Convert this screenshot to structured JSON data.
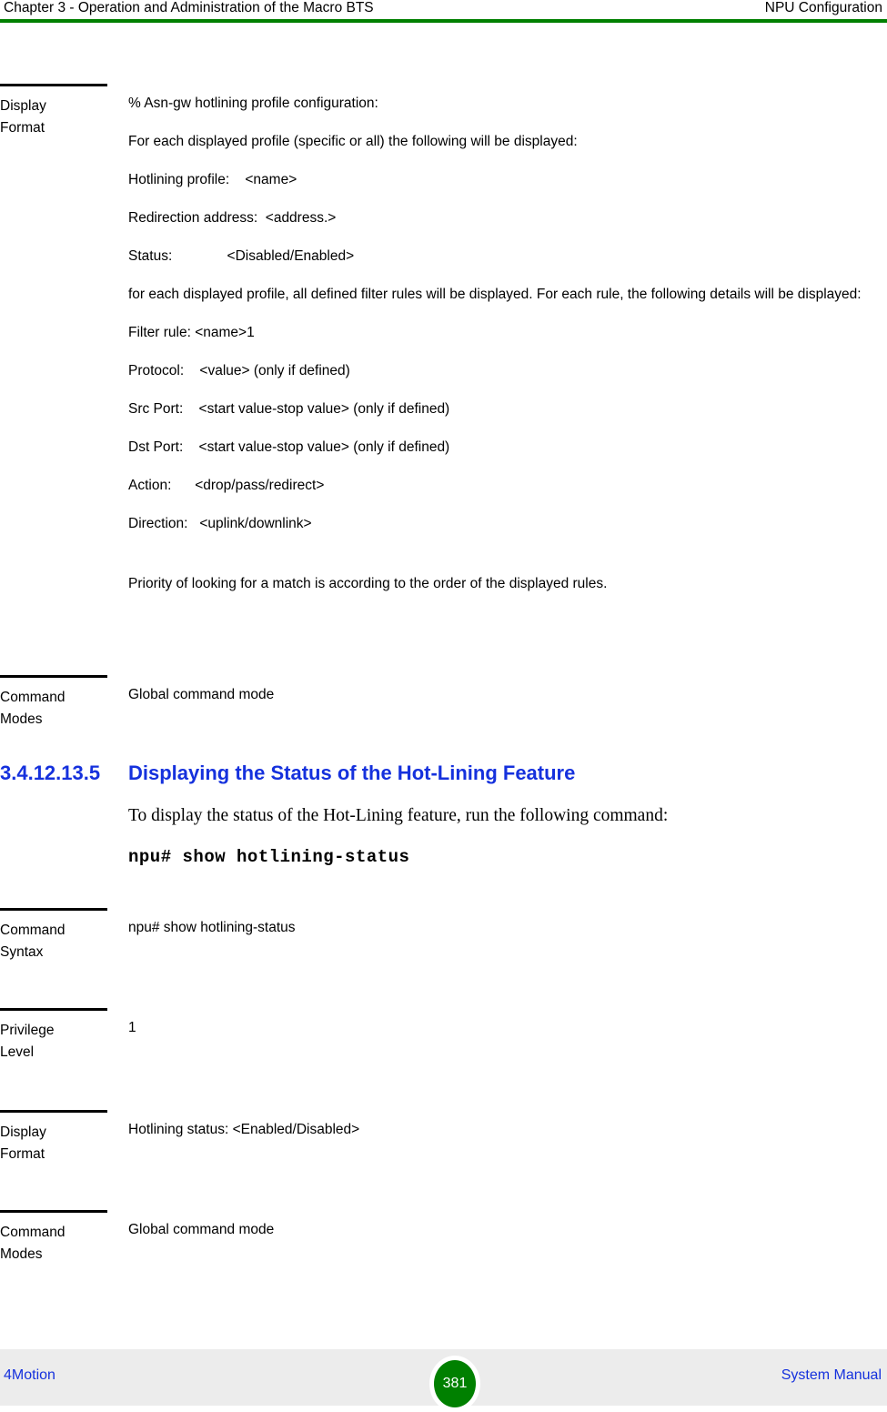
{
  "header": {
    "left": "Chapter 3 - Operation and Administration of the Macro BTS",
    "right": "NPU Configuration",
    "rule_color": "#008000"
  },
  "blocks": {
    "display_format_1": {
      "label_line1": "Display",
      "label_line2": "Format",
      "lines": [
        "% Asn-gw hotlining profile configuration:",
        "For each displayed profile (specific or all) the following will be displayed:",
        "Hotlining profile:    <name>",
        "Redirection address:  <address.>",
        "Status:              <Disabled/Enabled>",
        "for each displayed profile, all defined filter rules will be displayed. For each rule, the following details will be displayed:",
        "Filter rule: <name>1",
        "Protocol:    <value> (only if defined)",
        "Src Port:    <start value-stop value> (only if defined)",
        "Dst Port:    <start value-stop value> (only if defined)",
        "Action:      <drop/pass/redirect>",
        "Direction:   <uplink/downlink>",
        "Priority of looking for a match is according to the order of the displayed rules."
      ]
    },
    "command_modes_1": {
      "label_line1": "Command",
      "label_line2": "Modes",
      "value": "Global command mode"
    },
    "command_syntax": {
      "label_line1": "Command",
      "label_line2": "Syntax",
      "value": "npu# show hotlining-status"
    },
    "privilege_level": {
      "label_line1": "Privilege",
      "label_line2": "Level",
      "value": "1"
    },
    "display_format_2": {
      "label_line1": "Display",
      "label_line2": "Format",
      "value": "Hotlining status: <Enabled/Disabled>"
    },
    "command_modes_2": {
      "label_line1": "Command",
      "label_line2": "Modes",
      "value": "Global command mode"
    }
  },
  "section": {
    "number": "3.4.12.13.5",
    "title": "Displaying the Status of the Hot-Lining Feature",
    "color": "#1531dd",
    "intro": "To display the status of the Hot-Lining feature, run the following command:",
    "command": "npu# show hotlining-status"
  },
  "footer": {
    "left": "4Motion",
    "right": "System Manual",
    "page_number": "381",
    "badge_color": "#008000",
    "link_color": "#1531dd"
  }
}
